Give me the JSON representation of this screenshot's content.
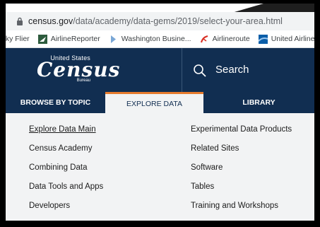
{
  "browser": {
    "url_domain": "census.gov",
    "url_path": "/data/academy/data-gems/2019/select-your-area.html"
  },
  "bookmarks": [
    {
      "label": "nky Flier",
      "icon": "none"
    },
    {
      "label": "AirlineReporter",
      "icon": "airline-reporter-icon"
    },
    {
      "label": "Washington Busine...",
      "icon": "washington-business-icon"
    },
    {
      "label": "Airlineroute",
      "icon": "airlineroute-icon"
    },
    {
      "label": "United Airlines",
      "icon": "united-airlines-icon"
    }
  ],
  "header": {
    "logo_top": "United States",
    "logo_main": "Census",
    "logo_bottom": "Bureau",
    "search_label": "Search",
    "background": "#112e51"
  },
  "nav": {
    "tabs": [
      {
        "label": "BROWSE BY TOPIC",
        "active": false
      },
      {
        "label": "EXPLORE DATA",
        "active": true
      },
      {
        "label": "LIBRARY",
        "active": false
      }
    ],
    "accent": "#e67b2d"
  },
  "menu": {
    "left": [
      "Explore Data Main",
      "Census Academy",
      "Combining Data",
      "Data Tools and Apps",
      "Developers"
    ],
    "right": [
      "Experimental Data Products",
      "Related Sites",
      "Software",
      "Tables",
      "Training and Workshops"
    ]
  }
}
